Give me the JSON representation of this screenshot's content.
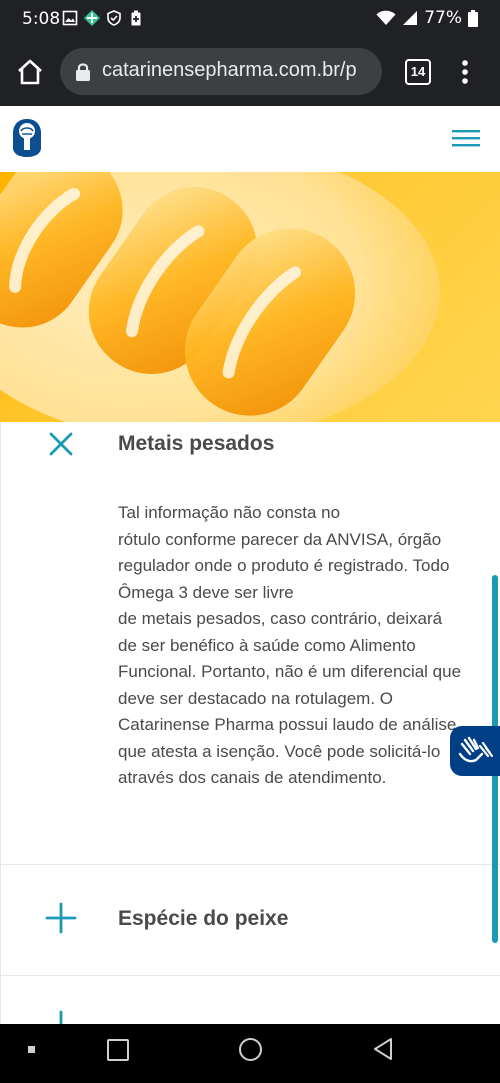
{
  "status_bar": {
    "time": "5:08",
    "battery": "77%"
  },
  "browser": {
    "url": "catarinensepharma.com.br/p",
    "tab_count": "14"
  },
  "site": {
    "accent_color": "#1b9ab5"
  },
  "accordion": {
    "items": [
      {
        "title": "Metais pesados",
        "state": "expanded",
        "icon": "close-icon",
        "body": [
          "Tal informação não consta no",
          "rótulo conforme parecer da ANVISA, órgão regulador onde o produto é registrado. Todo Ômega 3 deve ser livre",
          "de metais pesados, caso contrário, deixará de ser benéfico à saúde como Alimento Funcional. Portanto, não é um diferencial que deve ser destacado na rotulagem.  O Catarinense Pharma possui laudo de análise que atesta a isenção. Você pode solicitá-lo através dos canais de atendimento."
        ]
      },
      {
        "title": "Espécie do peixe",
        "state": "collapsed",
        "icon": "plus-icon"
      }
    ]
  }
}
